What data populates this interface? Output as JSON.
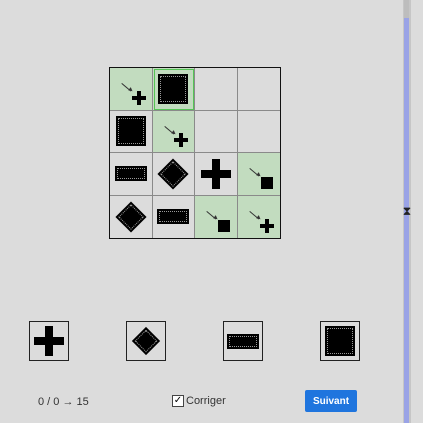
{
  "grid": {
    "rows": [
      [
        {
          "shape": "marker-plus",
          "green": true,
          "selected": false
        },
        {
          "shape": "square",
          "green": true,
          "selected": true
        },
        {
          "shape": "empty",
          "green": false,
          "selected": false
        },
        {
          "shape": "empty",
          "green": false,
          "selected": false
        }
      ],
      [
        {
          "shape": "square",
          "green": false,
          "selected": false
        },
        {
          "shape": "marker-plus",
          "green": true,
          "selected": false
        },
        {
          "shape": "empty",
          "green": false,
          "selected": false
        },
        {
          "shape": "empty",
          "green": false,
          "selected": false
        }
      ],
      [
        {
          "shape": "rect",
          "green": false,
          "selected": false
        },
        {
          "shape": "diamond",
          "green": false,
          "selected": false
        },
        {
          "shape": "plus",
          "green": false,
          "selected": false
        },
        {
          "shape": "marker-square",
          "green": true,
          "selected": false
        }
      ],
      [
        {
          "shape": "diamond",
          "green": false,
          "selected": false
        },
        {
          "shape": "rect",
          "green": false,
          "selected": false
        },
        {
          "shape": "marker-square",
          "green": true,
          "selected": false
        },
        {
          "shape": "marker-plus",
          "green": true,
          "selected": false
        }
      ]
    ]
  },
  "palette": [
    {
      "shape": "plus",
      "active": false
    },
    {
      "shape": "diamond",
      "active": false
    },
    {
      "shape": "rect",
      "active": false
    },
    {
      "shape": "square",
      "active": true
    }
  ],
  "footer": {
    "counter": "0 / 0 → 15",
    "check_label": "Corriger",
    "checked": true,
    "next_label": "Suivant"
  },
  "colors": {
    "cell_green": "#c2dcbf",
    "selected_outline": "#55c455",
    "button_blue": "#1f75de",
    "slider_fill": "#9aa3e6"
  },
  "icons": {
    "slider_handle": "hourglass-icon"
  }
}
